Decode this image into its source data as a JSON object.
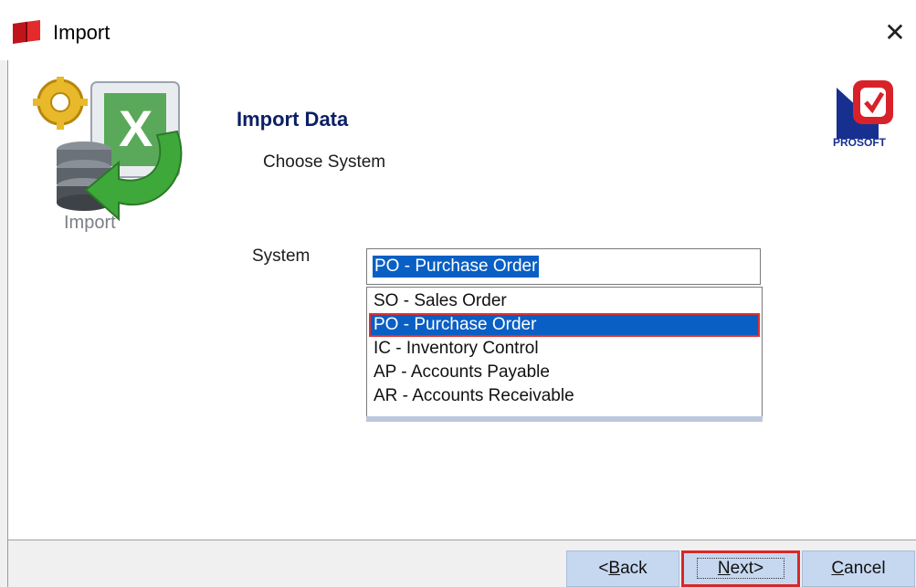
{
  "window": {
    "title": "Import",
    "close_icon": "close-icon"
  },
  "header": {
    "heading": "Import Data",
    "subheading": "Choose System",
    "graphic_caption": "Import",
    "logo_text": "PROSOFT"
  },
  "form": {
    "system_label": "System",
    "selected_value": "PO - Purchase Order",
    "options": [
      {
        "label": "SO - Sales Order",
        "selected": false
      },
      {
        "label": "PO - Purchase Order",
        "selected": true
      },
      {
        "label": "IC - Inventory Control",
        "selected": false
      },
      {
        "label": "AP - Accounts Payable",
        "selected": false
      },
      {
        "label": "AR - Accounts Receivable",
        "selected": false
      }
    ]
  },
  "buttons": {
    "back": {
      "prefix": "<",
      "mnemonic": "B",
      "rest": "ack"
    },
    "next": {
      "mnemonic": "N",
      "rest": "ext>"
    },
    "cancel": {
      "mnemonic": "C",
      "rest": "ancel"
    }
  },
  "colors": {
    "accent": "#0a5fc4",
    "heading": "#0b1f64",
    "highlight_border": "#e03030",
    "button_bg": "#c6d8f0"
  }
}
